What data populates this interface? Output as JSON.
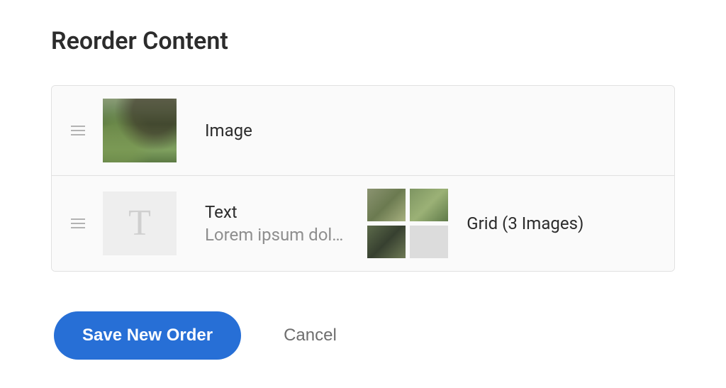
{
  "page": {
    "title": "Reorder Content"
  },
  "items": [
    {
      "type": "image",
      "label": "Image"
    },
    {
      "type": "text",
      "label": "Text",
      "subtitle": "Lorem ipsum dol…",
      "icon_glyph": "T"
    },
    {
      "type": "grid",
      "label": "Grid (3 Images)",
      "thumb_count": 3
    }
  ],
  "actions": {
    "save_label": "Save New Order",
    "cancel_label": "Cancel"
  }
}
